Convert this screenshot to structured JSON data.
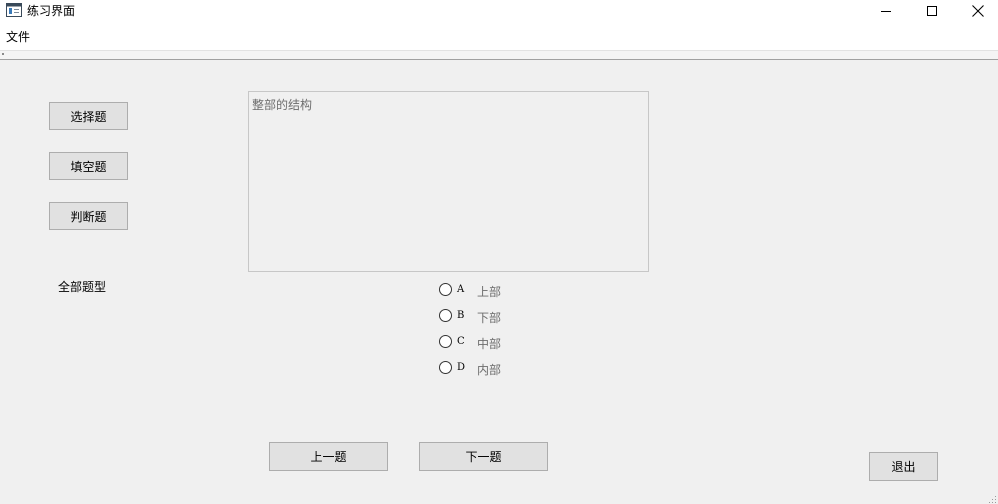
{
  "window": {
    "title": "练习界面",
    "icon": "app-window-icon",
    "controls": {
      "minimize": "minimize-icon",
      "maximize": "maximize-icon",
      "close": "close-icon"
    }
  },
  "menu": {
    "file_label": "文件"
  },
  "sidebar": {
    "buttons": [
      {
        "label": "选择题"
      },
      {
        "label": "填空题"
      },
      {
        "label": "判断题"
      }
    ],
    "all_types_label": "全部题型"
  },
  "question": {
    "text": "整部的结构"
  },
  "options": [
    {
      "letter": "A",
      "text": "上部"
    },
    {
      "letter": "B",
      "text": "下部"
    },
    {
      "letter": "C",
      "text": "中部"
    },
    {
      "letter": "D",
      "text": "内部"
    }
  ],
  "navigation": {
    "prev_label": "上一题",
    "next_label": "下一题"
  },
  "exit_label": "退出"
}
